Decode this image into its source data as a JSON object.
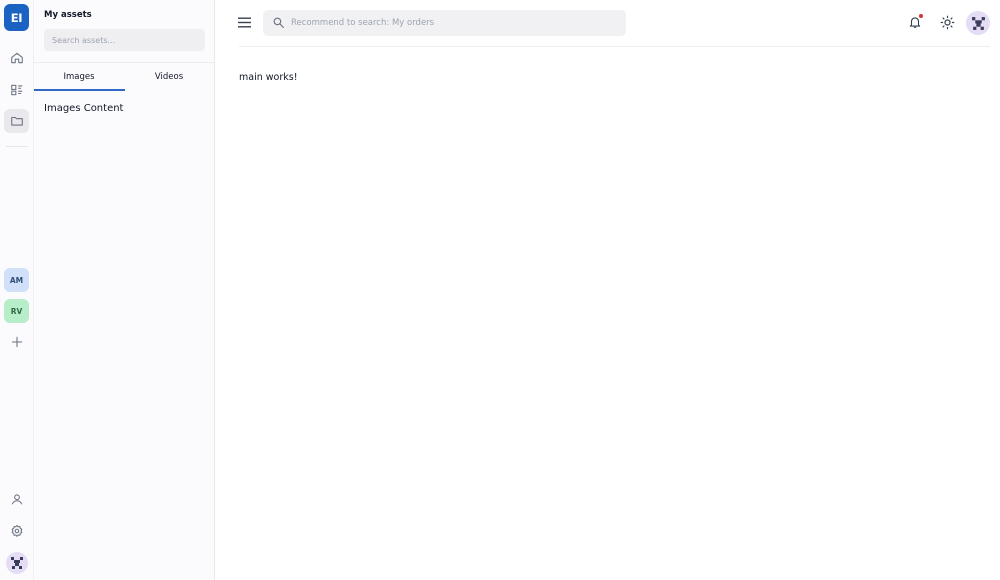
{
  "rail": {
    "brand": "EI",
    "workspaces": [
      {
        "initials": "AM",
        "color": "#cfe0f8"
      },
      {
        "initials": "RV",
        "color": "#b8edc9"
      }
    ],
    "icons": [
      "home-icon",
      "boards-icon",
      "folder-icon",
      "plus-icon",
      "user-icon",
      "settings-icon"
    ]
  },
  "assets": {
    "title": "My assets",
    "search_placeholder": "Search assets...",
    "tabs": [
      {
        "label": "Images",
        "active": true
      },
      {
        "label": "Videos",
        "active": false
      }
    ],
    "content": "Images Content"
  },
  "header": {
    "search_placeholder": "Recommend to search: My orders",
    "icons": [
      "menu-icon",
      "search-icon",
      "bell-icon",
      "sun-icon",
      "avatar"
    ],
    "notification_dot_color": "#e03131"
  },
  "main": {
    "text": "main works!"
  },
  "colors": {
    "brand": "#1b63c3",
    "accent": "#2f68c9"
  }
}
